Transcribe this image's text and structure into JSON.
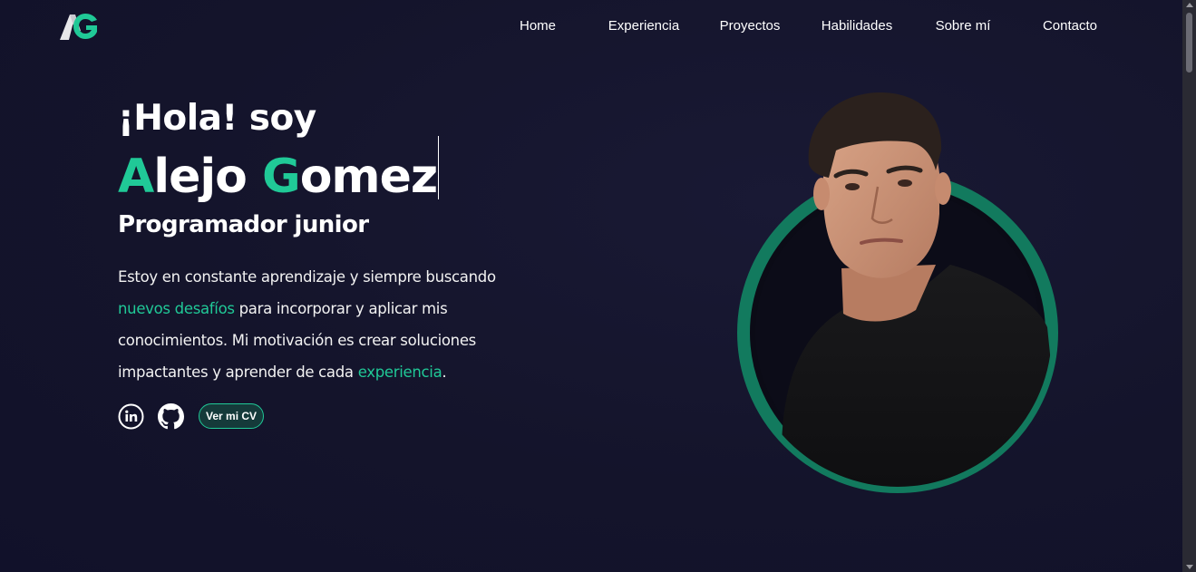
{
  "logo": {
    "text": "AG",
    "icon": "ag-logo-icon"
  },
  "nav": {
    "items": [
      {
        "label": "Home"
      },
      {
        "label": "Experiencia"
      },
      {
        "label": "Proyectos"
      },
      {
        "label": "Habilidades"
      },
      {
        "label": "Sobre mí"
      },
      {
        "label": "Contacto"
      }
    ]
  },
  "hero": {
    "greeting": "¡Hola! soy",
    "name": {
      "first_initial": "A",
      "first_rest": "lejo ",
      "last_initial": "G",
      "last_rest": "omez"
    },
    "role": "Programador junior",
    "description": {
      "part1": "Estoy en constante aprendizaje y siempre buscando ",
      "highlight1": "nuevos desafíos",
      "part2": " para incorporar y aplicar mis conocimientos. Mi motivación es crear soluciones impactantes y aprender de cada ",
      "highlight2": "experiencia",
      "part3": "."
    },
    "socials": [
      {
        "icon": "linkedin-icon"
      },
      {
        "icon": "github-icon"
      }
    ],
    "cv_button": "Ver mi CV"
  },
  "colors": {
    "accent": "#20c997",
    "background": "#14142b",
    "ring": "#127a5e"
  }
}
